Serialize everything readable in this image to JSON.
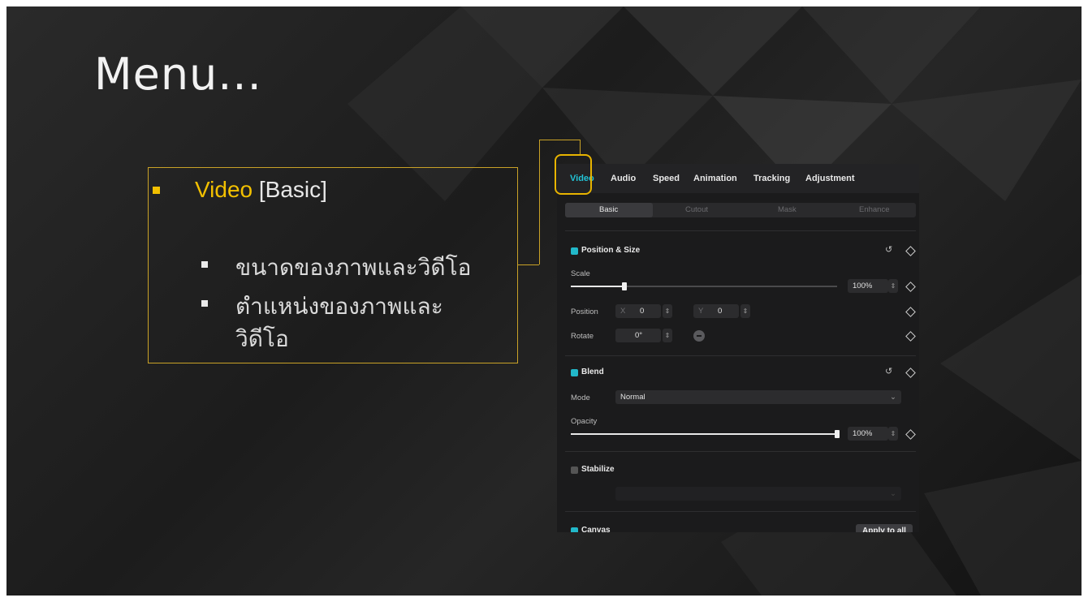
{
  "slide": {
    "title": "Menu...",
    "bullet_main": {
      "prefix": "Video",
      "suffix": " [Basic]"
    },
    "sub_bullets": [
      "ขนาดของภาพและวิดีโอ",
      "ตำแหน่งของภาพและ",
      "วิดีโอ"
    ],
    "accent_color": "#f2c000"
  },
  "panel": {
    "tabs": [
      "Video",
      "Audio",
      "Speed",
      "Animation",
      "Tracking",
      "Adjustment"
    ],
    "active_tab": "Video",
    "subtabs": [
      "Basic",
      "Cutout",
      "Mask",
      "Enhance"
    ],
    "active_subtab": "Basic",
    "position_size": {
      "title": "Position & Size",
      "scale_label": "Scale",
      "scale_value": "100%",
      "scale_fraction": 0.2,
      "position_label": "Position",
      "x_label": "X",
      "x_value": "0",
      "y_label": "Y",
      "y_value": "0",
      "rotate_label": "Rotate",
      "rotate_value": "0°"
    },
    "blend": {
      "title": "Blend",
      "mode_label": "Mode",
      "mode_value": "Normal",
      "opacity_label": "Opacity",
      "opacity_value": "100%",
      "opacity_fraction": 1.0
    },
    "stabilize": {
      "title": "Stabilize"
    },
    "canvas": {
      "title": "Canvas",
      "apply_label": "Apply to all"
    },
    "accent_color": "#22c3d6"
  }
}
